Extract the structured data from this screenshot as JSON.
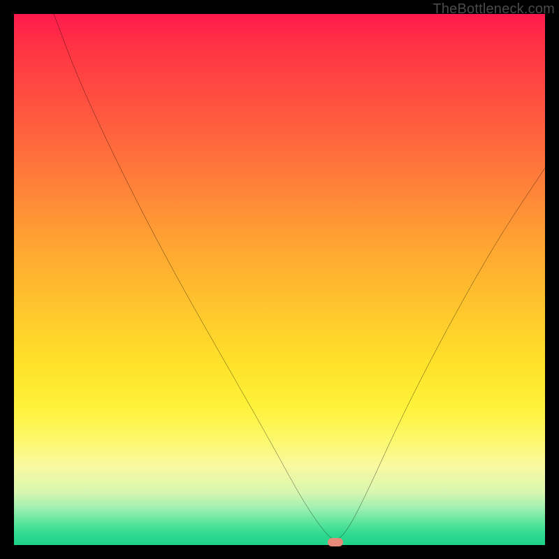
{
  "watermark": "TheBottleneck.com",
  "chart_data": {
    "type": "line",
    "title": "",
    "xlabel": "",
    "ylabel": "",
    "xlim": [
      0,
      100
    ],
    "ylim": [
      0,
      100
    ],
    "grid": false,
    "legend": false,
    "background_gradient": [
      "#ff1a4d",
      "#ff5540",
      "#ffa033",
      "#ffe22a",
      "#fdf86a",
      "#a0f0b0",
      "#1fd28a"
    ],
    "series": [
      {
        "name": "bottleneck-curve",
        "color": "#000000",
        "x": [
          7.5,
          12,
          18,
          25,
          32,
          40,
          48,
          54,
          58,
          60.5,
          63,
          67,
          72,
          78,
          85,
          92,
          100
        ],
        "y": [
          100,
          88,
          75,
          61,
          48,
          34,
          20,
          9,
          3,
          0.5,
          3,
          11,
          22,
          34,
          47,
          59,
          71
        ]
      }
    ],
    "annotations": [
      {
        "name": "min-marker",
        "shape": "pill",
        "color": "#e88a7a",
        "x": 60.5,
        "y": 0.5
      }
    ]
  }
}
